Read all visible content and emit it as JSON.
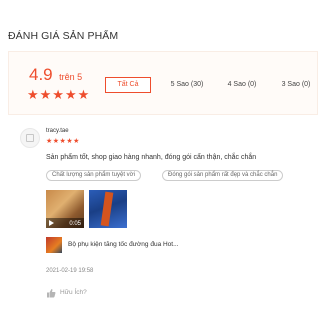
{
  "page": {
    "title": "ĐÁNH GIÁ SẢN PHẨM"
  },
  "summary": {
    "score": "4.9",
    "score_suffix": "trên 5",
    "stars": "★★★★★",
    "filters": [
      {
        "label": "Tất Cả",
        "active": true
      },
      {
        "label": "5 Sao (30)",
        "active": false
      },
      {
        "label": "4 Sao (0)",
        "active": false
      },
      {
        "label": "3 Sao (0)",
        "active": false
      }
    ]
  },
  "review": {
    "username": "tracy.tae",
    "stars": "★★★★★",
    "rating": 5,
    "comment": "Sản phẩm tốt, shop giao hàng nhanh, đóng gói cẩn thận, chắc chắn",
    "tags": [
      "Chất lượng sản phẩm tuyệt vời",
      "Đóng gói sản phẩm rất đẹp và chắc chắn"
    ],
    "video_duration": "0:05",
    "product_name": "Bộ phụ kiện tăng tốc đường đua Hot...",
    "timestamp": "2021-02-19 19:58",
    "helpful_label": "Hữu Ích?"
  },
  "colors": {
    "accent": "#ee4d2d",
    "summary_bg": "#fffbf8"
  },
  "icons": {
    "avatar": "avatar-placeholder-icon",
    "play": "play-icon",
    "helpful": "thumbs-up-icon"
  }
}
